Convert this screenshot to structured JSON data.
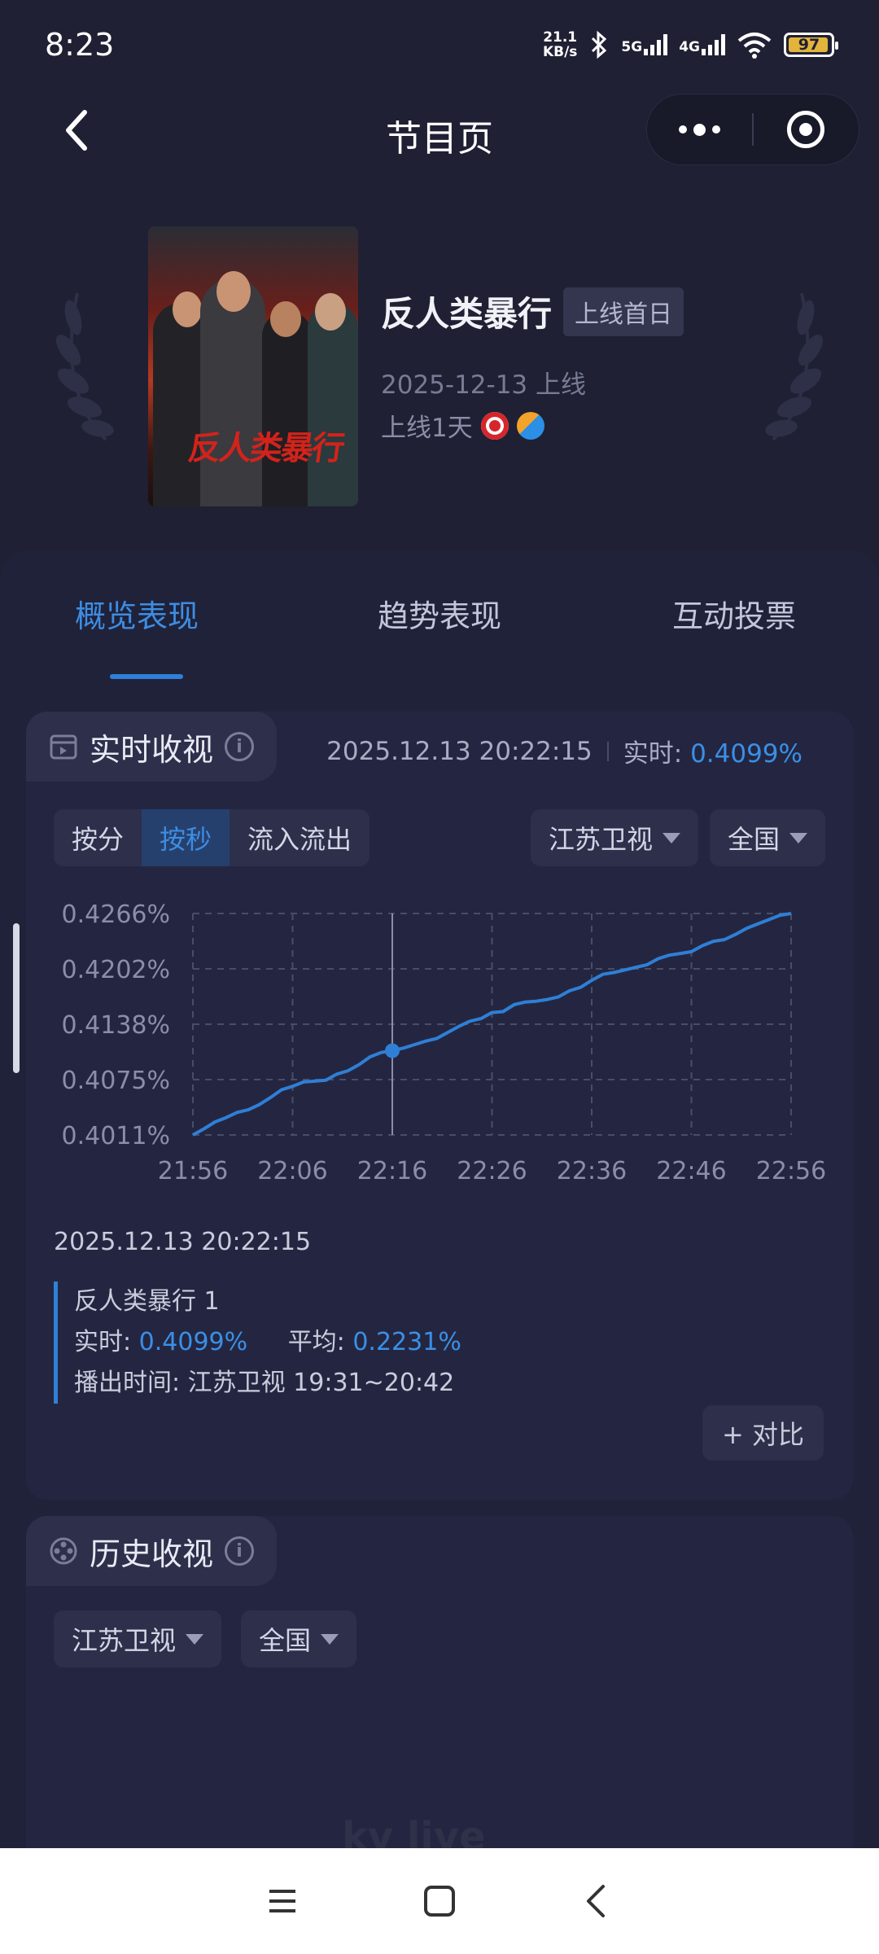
{
  "status_bar": {
    "time": "8:23",
    "speed_value": "21.1",
    "speed_unit": "KB/s",
    "net1": "5G",
    "net2": "4G",
    "battery": "97"
  },
  "nav": {
    "title": "节目页"
  },
  "show": {
    "title": "反人类暴行",
    "badge": "上线首日",
    "online_date": "2025-12-13 上线",
    "online_days": "上线1天",
    "poster_title": "反人类暴行"
  },
  "tabs": [
    {
      "label": "概览表现",
      "active": true
    },
    {
      "label": "趋势表现",
      "active": false
    },
    {
      "label": "互动投票",
      "active": false
    }
  ],
  "realtime": {
    "title": "实时收视",
    "timestamp": "2025.12.13 20:22:15",
    "realtime_label": "实时:",
    "realtime_value": "0.4099%",
    "segments": [
      "按分",
      "按秒",
      "流入流出"
    ],
    "active_segment": "按秒",
    "channel": "江苏卫视",
    "region": "全国",
    "legend_time": "2025.12.13 20:22:15",
    "legend_show": "反人类暴行 1",
    "legend_rt_label": "实时:",
    "legend_rt_value": "0.4099%",
    "legend_avg_label": "平均:",
    "legend_avg_value": "0.2231%",
    "legend_airing": "播出时间:  江苏卫视 19:31~20:42",
    "compare_button": "+ 对比"
  },
  "chart_data": {
    "type": "line",
    "x_ticks": [
      "21:56",
      "22:06",
      "22:16",
      "22:26",
      "22:36",
      "22:46",
      "22:56"
    ],
    "y_ticks": [
      "0.4266%",
      "0.4202%",
      "0.4138%",
      "0.4075%",
      "0.4011%"
    ],
    "ylim": [
      0.4011,
      0.4266
    ],
    "cursor_x": "22:16",
    "series": [
      {
        "color": "#2f7fd6",
        "x_minutes": [
          0,
          1,
          2,
          3,
          4,
          5,
          6,
          7,
          8,
          9,
          10,
          11,
          12,
          13,
          14,
          15,
          16,
          17,
          18,
          19,
          20,
          21,
          22,
          23,
          24,
          25,
          26,
          27,
          28,
          29,
          30,
          31,
          32,
          33,
          34,
          35,
          36,
          37,
          38,
          39,
          40,
          41,
          42,
          43,
          44,
          45,
          46,
          47,
          48,
          49,
          50,
          51,
          52,
          53,
          54,
          55,
          56,
          57,
          58,
          59,
          60
        ],
        "values": [
          0.4011,
          0.4018,
          0.4026,
          0.4031,
          0.4037,
          0.404,
          0.4046,
          0.4054,
          0.4063,
          0.4067,
          0.4072,
          0.4073,
          0.4074,
          0.4081,
          0.4085,
          0.4092,
          0.4101,
          0.4106,
          0.4108,
          0.4111,
          0.4115,
          0.4119,
          0.4122,
          0.4129,
          0.4136,
          0.4142,
          0.4145,
          0.4152,
          0.4153,
          0.4161,
          0.4164,
          0.4165,
          0.4167,
          0.417,
          0.4177,
          0.4181,
          0.4189,
          0.4196,
          0.4198,
          0.4201,
          0.4204,
          0.4207,
          0.4214,
          0.4218,
          0.422,
          0.4222,
          0.4229,
          0.4234,
          0.4236,
          0.4242,
          0.4249,
          0.4254,
          0.4259,
          0.4264,
          0.4266
        ]
      }
    ]
  },
  "history": {
    "title": "历史收视",
    "channel": "江苏卫视",
    "region": "全国"
  },
  "watermark": "kv live",
  "icons": {
    "back": "back-arrow-icon",
    "more": "more-dots-icon",
    "close": "target-icon",
    "realtime": "calendar-icon",
    "history": "film-reel-icon",
    "info": "info-icon"
  }
}
